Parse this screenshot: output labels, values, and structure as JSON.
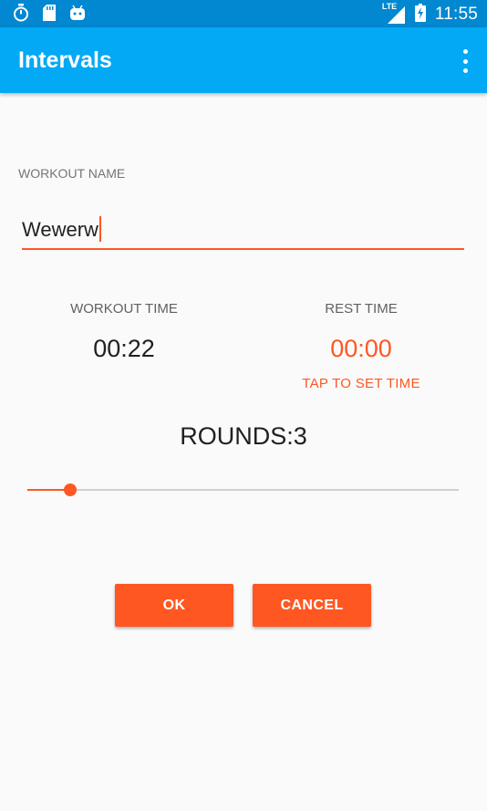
{
  "status_bar": {
    "time": "11:55",
    "network": "LTE",
    "icons": [
      "stopwatch-icon",
      "sd-card-icon",
      "android-icon",
      "signal-icon",
      "battery-charging-icon"
    ]
  },
  "app_bar": {
    "title": "Intervals",
    "menu_icon": "more-vert-icon"
  },
  "workout_name": {
    "label": "WORKOUT NAME",
    "value": "Wewerw"
  },
  "workout_time": {
    "label": "WORKOUT TIME",
    "value": "00:22"
  },
  "rest_time": {
    "label": "REST TIME",
    "value": "00:00",
    "hint": "TAP TO SET TIME"
  },
  "rounds": {
    "text": "ROUNDS:3",
    "slider_fraction": 0.1
  },
  "buttons": {
    "ok": "OK",
    "cancel": "CANCEL"
  },
  "colors": {
    "status_bar": "#0288d1",
    "app_bar": "#03a9f4",
    "accent": "#ff5722",
    "background": "#fafafa"
  }
}
